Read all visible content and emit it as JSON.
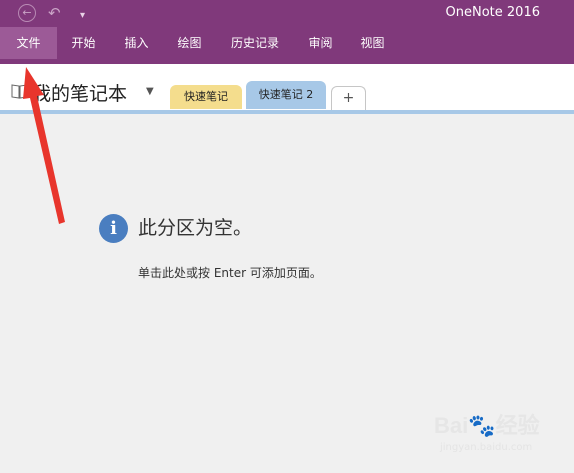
{
  "app": {
    "title": "OneNote 2016"
  },
  "quick_access": {
    "back_icon": "back-icon",
    "undo_icon": "undo-icon",
    "more_icon": "customize-icon"
  },
  "ribbon": {
    "tabs": [
      {
        "label": "文件",
        "active": true
      },
      {
        "label": "开始"
      },
      {
        "label": "插入"
      },
      {
        "label": "绘图"
      },
      {
        "label": "历史记录"
      },
      {
        "label": "审阅"
      },
      {
        "label": "视图"
      }
    ],
    "color": "#80397b"
  },
  "notebook": {
    "title": "我的笔记本",
    "icon": "notebook-icon"
  },
  "sections": [
    {
      "label": "快速笔记",
      "color": "#f4dd8d"
    },
    {
      "label": "快速笔记 2",
      "color": "#a7c8e7",
      "active": true
    },
    {
      "label": "+"
    }
  ],
  "main": {
    "heading": "此分区为空。",
    "hint": "单击此处或按 Enter 可添加页面。",
    "info_icon": "i"
  },
  "annotation": {
    "color": "#e8352c"
  },
  "watermark": {
    "text": "Bai🐾经验",
    "sub": "jingyan.baidu.com"
  }
}
